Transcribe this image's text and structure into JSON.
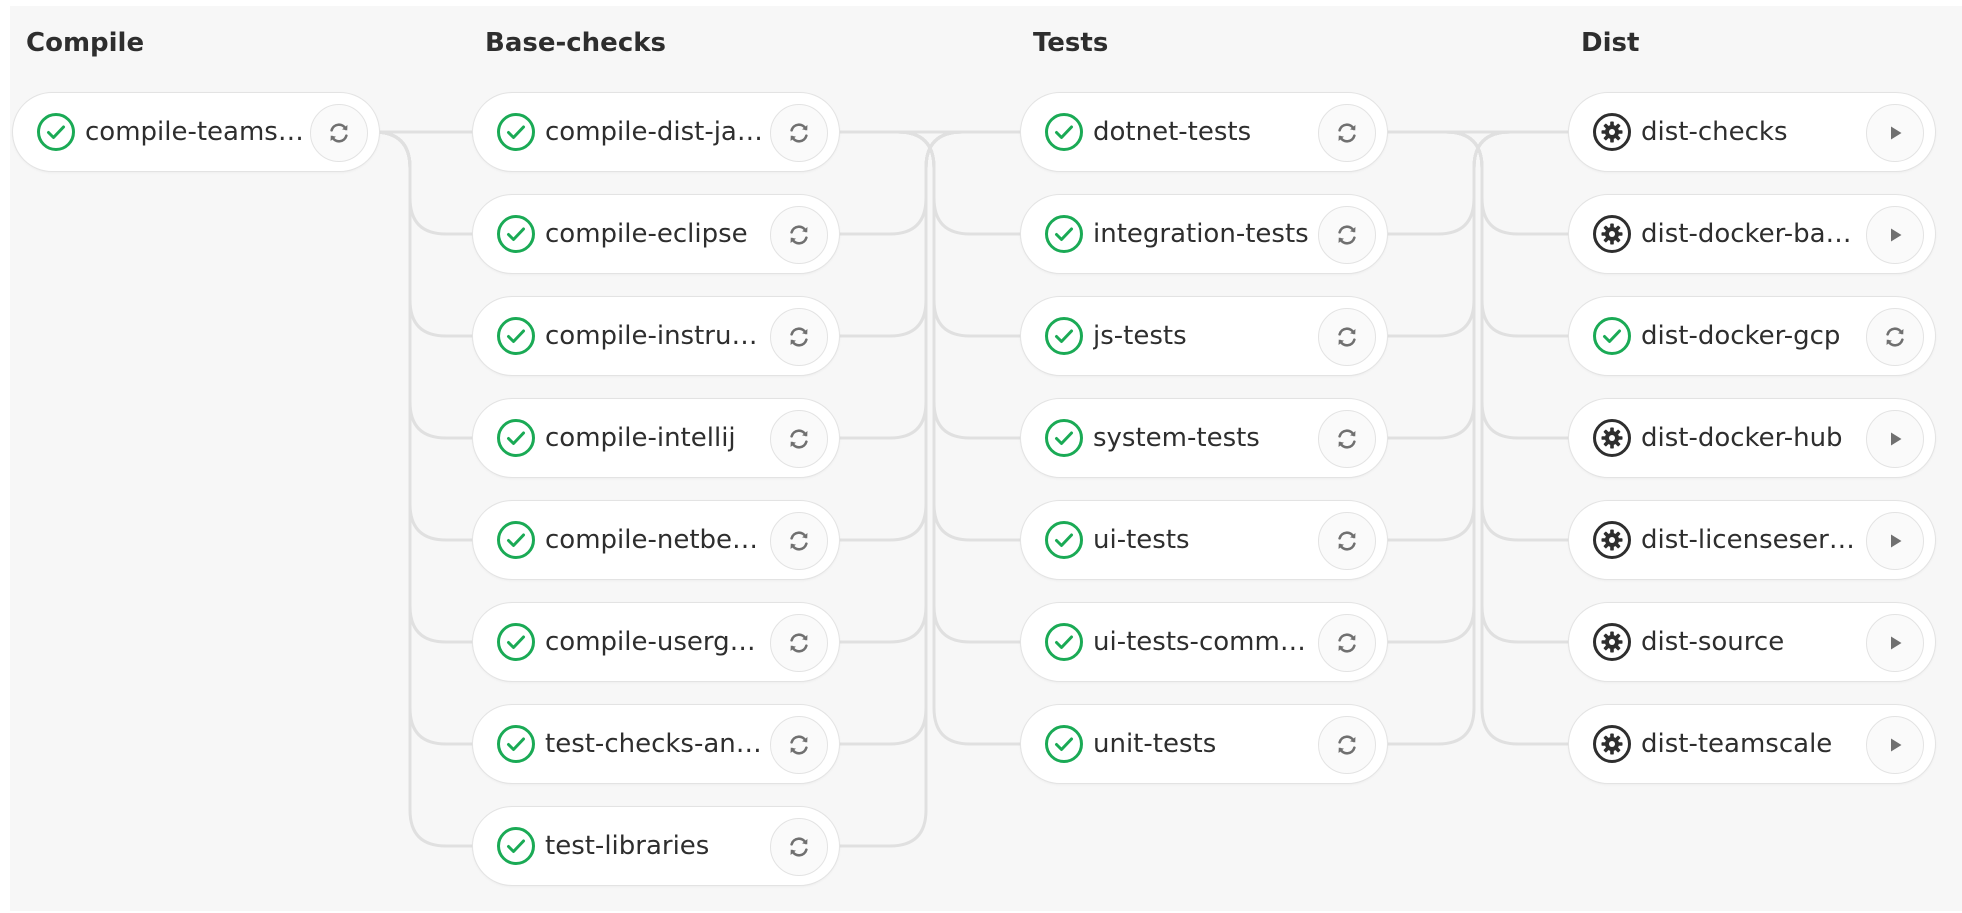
{
  "stages": [
    {
      "title": "Compile",
      "jobs": [
        {
          "name": "compile-teamsc…",
          "status": "success",
          "action": "retry"
        }
      ]
    },
    {
      "title": "Base-checks",
      "jobs": [
        {
          "name": "compile-dist-jav…",
          "status": "success",
          "action": "retry"
        },
        {
          "name": "compile-eclipse",
          "status": "success",
          "action": "retry"
        },
        {
          "name": "compile-instrum…",
          "status": "success",
          "action": "retry"
        },
        {
          "name": "compile-intellij",
          "status": "success",
          "action": "retry"
        },
        {
          "name": "compile-netbeans",
          "status": "success",
          "action": "retry"
        },
        {
          "name": "compile-usergui…",
          "status": "success",
          "action": "retry"
        },
        {
          "name": "test-checks-and…",
          "status": "success",
          "action": "retry"
        },
        {
          "name": "test-libraries",
          "status": "success",
          "action": "retry"
        }
      ]
    },
    {
      "title": "Tests",
      "jobs": [
        {
          "name": "dotnet-tests",
          "status": "success",
          "action": "retry"
        },
        {
          "name": "integration-tests",
          "status": "success",
          "action": "retry"
        },
        {
          "name": "js-tests",
          "status": "success",
          "action": "retry"
        },
        {
          "name": "system-tests",
          "status": "success",
          "action": "retry"
        },
        {
          "name": "ui-tests",
          "status": "success",
          "action": "retry"
        },
        {
          "name": "ui-tests-commo…",
          "status": "success",
          "action": "retry"
        },
        {
          "name": "unit-tests",
          "status": "success",
          "action": "retry"
        }
      ]
    },
    {
      "title": "Dist",
      "jobs": [
        {
          "name": "dist-checks",
          "status": "manual",
          "action": "play"
        },
        {
          "name": "dist-docker-bas…",
          "status": "manual",
          "action": "play"
        },
        {
          "name": "dist-docker-gcp",
          "status": "success",
          "action": "retry"
        },
        {
          "name": "dist-docker-hub",
          "status": "manual",
          "action": "play"
        },
        {
          "name": "dist-licenseserver",
          "status": "manual",
          "action": "play"
        },
        {
          "name": "dist-source",
          "status": "manual",
          "action": "play"
        },
        {
          "name": "dist-teamscale",
          "status": "manual",
          "action": "play"
        }
      ]
    }
  ],
  "icons": {
    "success": "check-circle-icon",
    "manual": "gear-icon",
    "retry": "retry-icon",
    "play": "play-icon"
  },
  "colors": {
    "success": "#1aaa55",
    "manual": "#2e2e2e",
    "connector": "#e0e0e0",
    "action_icon": "#707070",
    "background": "#f7f7f7"
  }
}
